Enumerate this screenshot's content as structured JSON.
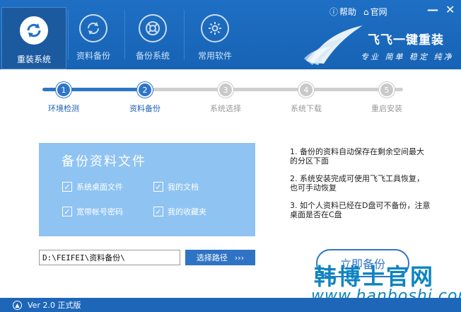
{
  "nav": {
    "items": [
      {
        "label": "重装系统",
        "icon": "refresh-icon",
        "active": true
      },
      {
        "label": "资料备份",
        "icon": "sync-icon",
        "active": false
      },
      {
        "label": "备份系统",
        "icon": "lifebuoy-icon",
        "active": false
      },
      {
        "label": "常用软件",
        "icon": "gear-icon",
        "active": false
      }
    ]
  },
  "top_links": {
    "help": "帮助",
    "site": "官网"
  },
  "brand": {
    "title": "飞飞一键重装",
    "subtitle": "专业 简单 稳定 纯净"
  },
  "steps": [
    {
      "num": "1",
      "label": "环境检测",
      "done": true
    },
    {
      "num": "2",
      "label": "资料备份",
      "done": true
    },
    {
      "num": "3",
      "label": "系统选择",
      "done": false
    },
    {
      "num": "4",
      "label": "系统下载",
      "done": false
    },
    {
      "num": "5",
      "label": "重启安装",
      "done": false
    }
  ],
  "panel": {
    "title": "备份资料文件",
    "checks": [
      {
        "label": "系统桌面文件",
        "checked": true
      },
      {
        "label": "我的文档",
        "checked": true
      },
      {
        "label": "宽带帐号密码",
        "checked": true
      },
      {
        "label": "我的收藏夹",
        "checked": true
      }
    ]
  },
  "path": {
    "value": "D:\\FEIFEI\\资料备份\\",
    "button": "选择路径",
    "button_arrows": "›››"
  },
  "notes": [
    "1. 备份的资料自动保存在剩余空间最大的分区下面",
    "2. 系统安装完成可使用飞飞工具恢复，也可手动恢复",
    "3. 如个人资料已经在D盘可不备份，注意桌面是否在C盘"
  ],
  "start_button": "立即备份",
  "watermark": {
    "cn": "韩博士官网",
    "en": "www.hanboshi.com"
  },
  "footer": {
    "version": "Ver 2.0 正式版"
  },
  "colors": {
    "header": "#1e6fc4",
    "accent": "#2f75c8",
    "panel": "#8fc3f2",
    "inactive_step": "#c9c9c9"
  }
}
